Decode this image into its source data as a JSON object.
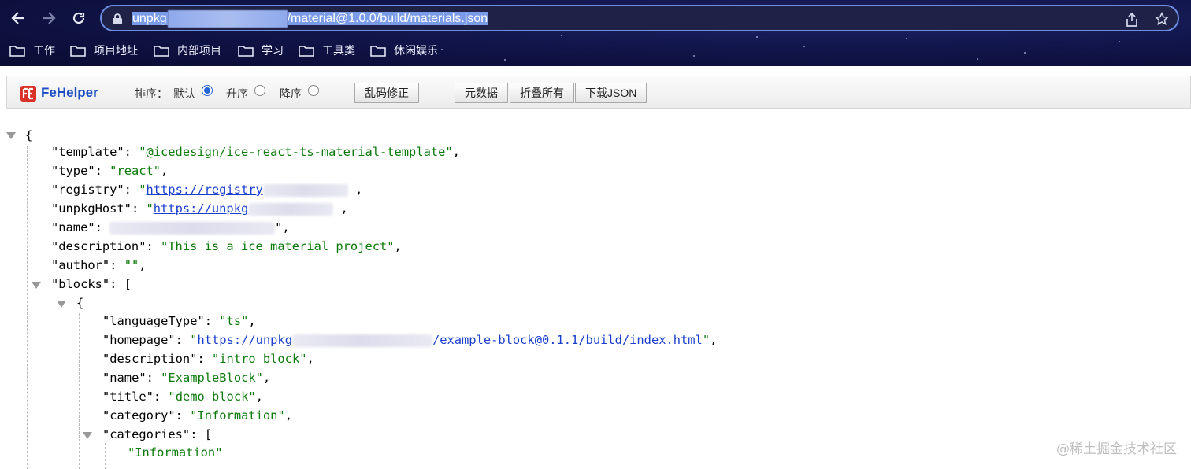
{
  "browser": {
    "back_icon": "arrow-left-icon",
    "forward_icon": "arrow-right-icon",
    "reload_icon": "reload-icon",
    "url_host": "unpkg",
    "url_path": "/material@1.0.0/build/materials.json",
    "share_icon": "share-icon",
    "bookmark_icon": "star-icon",
    "bookmarks": [
      {
        "label": "工作"
      },
      {
        "label": "项目地址"
      },
      {
        "label": "内部项目"
      },
      {
        "label": "学习"
      },
      {
        "label": "工具类"
      },
      {
        "label": "休闲娱乐"
      }
    ]
  },
  "fehelper": {
    "name": "FeHelper",
    "sort_label": "排序：",
    "sort_options": [
      {
        "label": "默认",
        "checked": true
      },
      {
        "label": "升序",
        "checked": false
      },
      {
        "label": "降序",
        "checked": false
      }
    ],
    "fix_encoding": "乱码修正",
    "buttons": [
      "元数据",
      "折叠所有",
      "下载JSON"
    ]
  },
  "json_view": {
    "open_brace": "{",
    "template_key": "\"template\"",
    "template_val": "\"@icedesign/ice-react-ts-material-template\"",
    "type_key": "\"type\"",
    "type_val": "\"react\"",
    "registry_key": "\"registry\"",
    "registry_val": "https://registry",
    "unpkg_key": "\"unpkgHost\"",
    "unpkg_val": "https://unpkg",
    "name_key": "\"name\"",
    "description_key": "\"description\"",
    "description_val": "\"This is a ice material project\"",
    "author_key": "\"author\"",
    "author_val": "\"\"",
    "blocks_key": "\"blocks\"",
    "block": {
      "languageType_key": "\"languageType\"",
      "languageType_val": "\"ts\"",
      "homepage_key": "\"homepage\"",
      "homepage_val_start": "https://unpkg",
      "homepage_val_end": "/example-block@0.1.1/build/index.html",
      "description_key": "\"description\"",
      "description_val": "\"intro block\"",
      "name_key": "\"name\"",
      "name_val": "\"ExampleBlock\"",
      "title_key": "\"title\"",
      "title_val": "\"demo block\"",
      "category_key": "\"category\"",
      "category_val": "\"Information\"",
      "categories_key": "\"categories\"",
      "categories_item": "\"Information\""
    }
  },
  "watermark": "@稀土掘金技术社区",
  "colors": {
    "key": "#000000",
    "string": "#0b7a0b",
    "link": "#1a3fcf",
    "brand": "#1d4fc1"
  }
}
